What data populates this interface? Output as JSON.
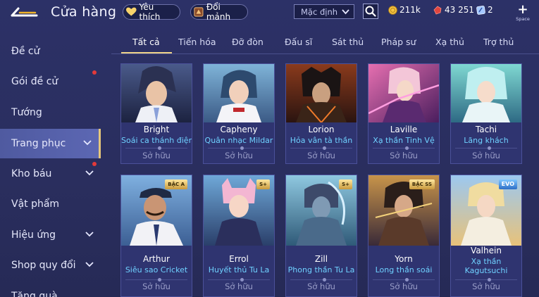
{
  "header": {
    "title": "Cửa hàng",
    "favorites_label": "Yêu thích",
    "fragments_label": "Đổi mảnh",
    "sort_value": "Mặc định",
    "gold": "211k",
    "ruby": "43 251",
    "voucher": "2",
    "add_hint": "Space"
  },
  "sidebar": {
    "items": [
      {
        "label": "Đề cử"
      },
      {
        "label": "Gói đề cử"
      },
      {
        "label": "Tướng"
      },
      {
        "label": "Trang phục"
      },
      {
        "label": "Kho báu"
      },
      {
        "label": "Vật phẩm"
      },
      {
        "label": "Hiệu ứng"
      },
      {
        "label": "Shop quy đổi"
      },
      {
        "label": "Tặng quà"
      }
    ]
  },
  "tabs": [
    {
      "label": "Tất cả"
    },
    {
      "label": "Tiến hóa"
    },
    {
      "label": "Đỡ đòn"
    },
    {
      "label": "Đấu sĩ"
    },
    {
      "label": "Sát thủ"
    },
    {
      "label": "Pháp sư"
    },
    {
      "label": "Xạ thủ"
    },
    {
      "label": "Trợ thủ"
    }
  ],
  "cards": [
    {
      "hero": "Bright",
      "skin": "Soái ca thánh điện",
      "status": "Sở hữu"
    },
    {
      "hero": "Capheny",
      "skin": "Quân nhạc Mildar",
      "status": "Sở hữu"
    },
    {
      "hero": "Lorion",
      "skin": "Hỏa vân tà thần",
      "status": "Sở hữu"
    },
    {
      "hero": "Laville",
      "skin": "Xạ thần Tinh Vệ",
      "status": "Sở hữu"
    },
    {
      "hero": "Tachi",
      "skin": "Lãng khách",
      "status": "Sở hữu"
    },
    {
      "hero": "Arthur",
      "skin": "Siêu sao Cricket",
      "status": "Sở hữu",
      "badge": "BẬC A"
    },
    {
      "hero": "Errol",
      "skin": "Huyết thủ Tu La",
      "status": "Sở hữu",
      "badge": "S+"
    },
    {
      "hero": "Zill",
      "skin": "Phong thần Tu La",
      "status": "Sở hữu",
      "badge": "S+"
    },
    {
      "hero": "Yorn",
      "skin": "Long thần soái",
      "status": "Sở hữu",
      "badge": "BẬC SS"
    },
    {
      "hero": "Valhein",
      "skin": "Xạ thần Kagutsuchi",
      "status": "Sở hữu",
      "badge": "EVO"
    }
  ]
}
